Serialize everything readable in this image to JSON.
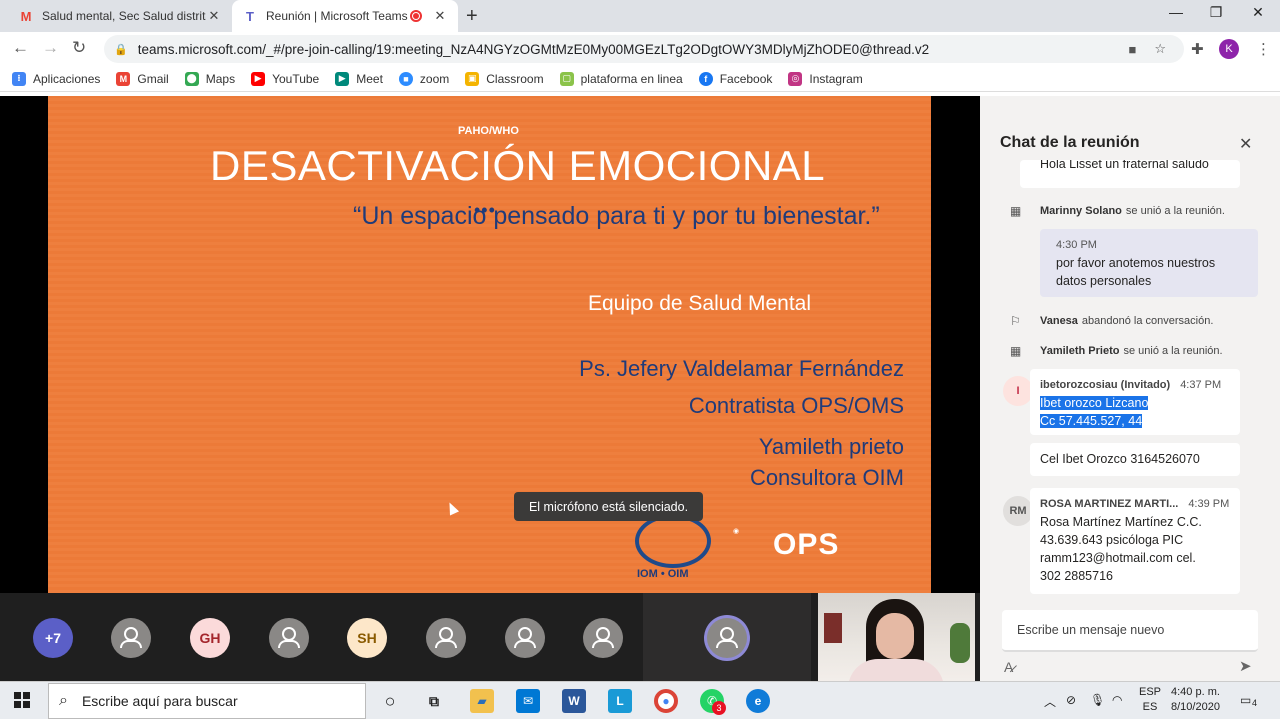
{
  "tabs": [
    {
      "label": "Salud mental, Sec Salud distrital -",
      "icon": "gmail-icon"
    },
    {
      "label": "Reunión | Microsoft Teams",
      "icon": "teams-icon"
    }
  ],
  "address_bar": {
    "url": "teams.microsoft.com/_#/pre-join-calling/19:meeting_NzA4NGYzOGMtMzE0My00MGEzLTg2ODgtOWY3MDlyMjZhODE0@thread.v2"
  },
  "profile_initial": "K",
  "bookmarks": [
    {
      "label": "Aplicaciones",
      "color": "#4285f4"
    },
    {
      "label": "Gmail",
      "color": "#ea4335"
    },
    {
      "label": "Maps",
      "color": "#34a853"
    },
    {
      "label": "YouTube",
      "color": "#ff0000"
    },
    {
      "label": "Meet",
      "color": "#00897b"
    },
    {
      "label": "zoom",
      "color": "#2d8cff"
    },
    {
      "label": "Classroom",
      "color": "#f4b400"
    },
    {
      "label": "plataforma en linea",
      "color": "#8bc34a"
    },
    {
      "label": "Facebook",
      "color": "#1877f2"
    },
    {
      "label": "Instagram",
      "color": "#c13584"
    }
  ],
  "slide": {
    "org": "PAHO/WHO",
    "title": "DESACTIVACIÓN EMOCIONAL",
    "subtitle": "“Un espacio pensado para ti y por tu bienestar.”",
    "team": "Equipo de Salud Mental",
    "presenter1": "Ps. Jefery Valdelamar Fernández",
    "presenter1_role": "Contratista OPS/OMS",
    "presenter2": "Yamileth prieto",
    "presenter2_role": "Consultora OIM",
    "logo_iom": "IOM • OIM",
    "logo_ops": "OPS"
  },
  "mute_toast": "El micrófono está silenciado.",
  "participants": [
    {
      "label": "+7",
      "bg": "#5b5fc7"
    },
    {
      "label": "",
      "bg": "#8a8886"
    },
    {
      "label": "GH",
      "bg": "#fbdada"
    },
    {
      "label": "",
      "bg": "#8a8886"
    },
    {
      "label": "SH",
      "bg": "#fde7c9"
    },
    {
      "label": "",
      "bg": "#8a8886"
    },
    {
      "label": "",
      "bg": "#8a8886"
    },
    {
      "label": "",
      "bg": "#8a8886"
    }
  ],
  "chat": {
    "title": "Chat de la reunión",
    "truncated_message": "Hola Lisset un fraternal saludo",
    "events": [
      {
        "name": "Marinny Solano",
        "text": "se unió a la reunión."
      },
      {
        "name": "Vanesa",
        "text": "abandonó la conversación."
      },
      {
        "name": "Yamileth Prieto",
        "text": "se unió a la reunión."
      }
    ],
    "my_message": {
      "time": "4:30 PM",
      "lines": [
        "por favor anotemos nuestros",
        "datos personales"
      ]
    },
    "msg1": {
      "initial": "I",
      "sender": "ibetorozcosiau (Invitado)",
      "time": "4:37 PM",
      "lines": [
        "Ibet orozco Lizcano",
        "Cc 57.445.527, 44"
      ]
    },
    "msg1_followup": "Cel Ibet Orozco 3164526070",
    "msg2": {
      "initial": "RM",
      "sender": "ROSA MARTINEZ MARTI...",
      "time": "4:39 PM",
      "lines": [
        "Rosa Martínez Martínez C.C.",
        "43.639.643 psicóloga PIC",
        "ramm123@hotmail.com cel.",
        "302 2885716"
      ]
    },
    "composer_placeholder": "Escribe un mensaje nuevo"
  },
  "taskbar": {
    "search_placeholder": "Escribe aquí para buscar",
    "whatsapp_badge": "3",
    "lang_top": "ESP",
    "lang_bottom": "ES",
    "time": "4:40 p. m.",
    "date": "8/10/2020",
    "notif_count": "4"
  }
}
